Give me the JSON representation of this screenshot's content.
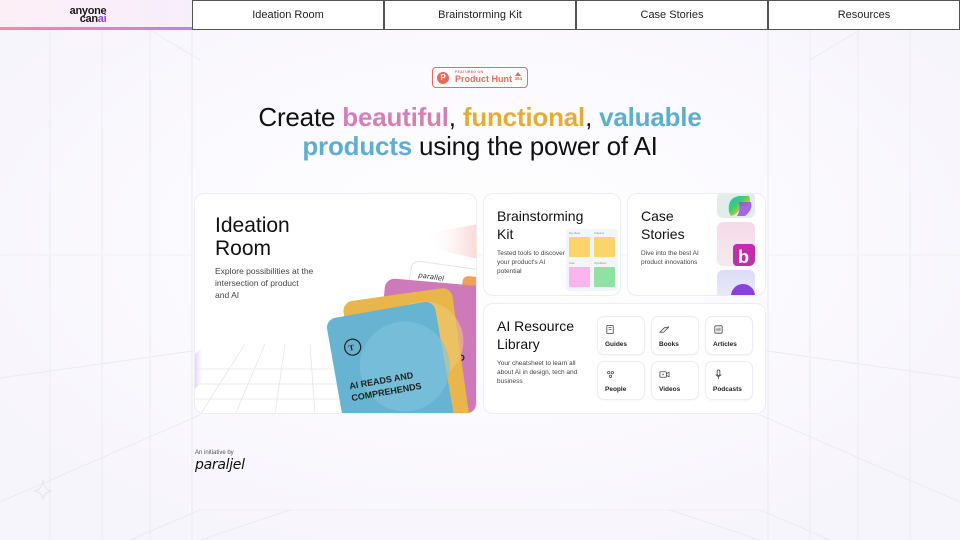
{
  "nav": {
    "logo_line1": "anyone",
    "logo_line2_prefix": "can",
    "logo_line2_suffix": "ai",
    "items": [
      {
        "label": "Ideation Room"
      },
      {
        "label": "Brainstorming Kit"
      },
      {
        "label": "Case Stories"
      },
      {
        "label": "Resources"
      }
    ]
  },
  "badge": {
    "featured_on": "FEATURED ON",
    "name": "Product Hunt",
    "letter": "P",
    "count": "364",
    "color": "#e86a5a"
  },
  "headline": {
    "w1": "Create ",
    "w2": "beautiful",
    "w3": ", ",
    "w4": "functional",
    "w5": ", ",
    "w6": "valuable",
    "w7": "products",
    "w8": " using the power of AI",
    "colors": {
      "pink": "#d57fb8",
      "yellow": "#e3ac3a",
      "blue": "#5eaed0"
    }
  },
  "cards": {
    "ideation": {
      "title_line1": "Ideation",
      "title_line2": "Room",
      "subtitle": "Explore possibilities at the intersection of product and AI",
      "card_front_text": "AI READS AND COMPREHENDS",
      "card_back_text_1": "ND",
      "card_back_text_2": "A",
      "card_brand": "parallel"
    },
    "brainstorm": {
      "title_line1": "Brainstorming",
      "title_line2": "Kit",
      "subtitle": "Tested tools to discover your product's AI potential",
      "sticky_labels": [
        "Key Ideas",
        "Outcome",
        "Goal",
        "Hypothesis"
      ]
    },
    "case": {
      "title_line1": "Case",
      "title_line2": "Stories",
      "subtitle": "Dive into the best AI product innovations"
    },
    "library": {
      "title_line1": "AI Resource",
      "title_line2": "Library",
      "subtitle": "Your cheatsheet to learn all about AI in design, tech and business",
      "tiles": [
        {
          "label": "Guides",
          "icon": "guide-icon"
        },
        {
          "label": "Books",
          "icon": "book-icon"
        },
        {
          "label": "Articles",
          "icon": "article-icon"
        },
        {
          "label": "People",
          "icon": "people-icon"
        },
        {
          "label": "Videos",
          "icon": "video-icon"
        },
        {
          "label": "Podcasts",
          "icon": "microphone-icon"
        }
      ]
    }
  },
  "footer": {
    "initiative": "An initiative by",
    "brand": "paraljel"
  }
}
